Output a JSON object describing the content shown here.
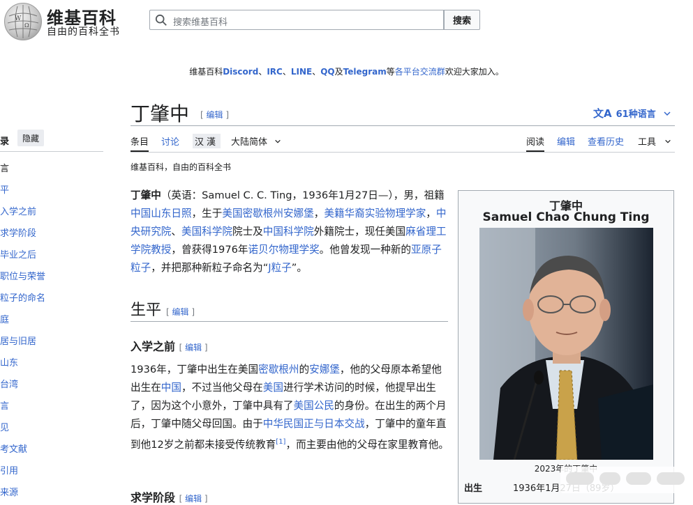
{
  "site": {
    "title": "维基百科",
    "tagline": "自由的百科全书"
  },
  "search": {
    "placeholder": "搜索维基百科",
    "button": "搜索"
  },
  "banner": {
    "prefix": "维基百科",
    "discord": "Discord",
    "sep1": "、",
    "irc": "IRC",
    "sep2": "、",
    "line": "LINE",
    "sep3": "、",
    "qq": "QQ",
    "and": "及",
    "telegram": "Telegram",
    "mid": "等",
    "link": "各平台交流群",
    "suffix": "欢迎大家加入。"
  },
  "toc": {
    "title": "录",
    "hide_button": "隐藏",
    "items": [
      "言",
      "平",
      "入学之前",
      "求学阶段",
      "毕业之后",
      "职位与荣誉",
      "粒子的命名",
      "庭",
      "居与旧居",
      "山东",
      "台湾",
      "言",
      "见",
      "考文献",
      "引用",
      "来源"
    ]
  },
  "page": {
    "title": "丁肇中",
    "edit": "编辑",
    "languages": "61种语言"
  },
  "tabs": {
    "article": "条目",
    "talk": "讨论",
    "variant": "汉漢",
    "variant_menu": "大陆简体",
    "read": "阅读",
    "edit": "编辑",
    "history": "查看历史",
    "tools": "工具"
  },
  "from_line": "维基百科，自由的百科全书",
  "lead": {
    "t1": "丁肇中",
    "t2": "（英语：Samuel C. C. Ting，1936年1月27日—），男，祖籍",
    "l1": "中国山东日照",
    "t3": "，生于",
    "l2": "美国密歇根州安娜堡",
    "t4": "，",
    "l3": "美籍华裔实验物理学家",
    "t5": "，",
    "l4": "中央研究院",
    "t6": "、",
    "l5": "美国科学院",
    "t7": "院士及",
    "l6": "中国科学院",
    "t8": "外籍院士，现任美国",
    "l7": "麻省理工学院教授",
    "t9": "，曾获得1976年",
    "l8": "诺贝尔物理学奖",
    "t10": "。他曾发现一种新的",
    "l9": "亚原子粒子",
    "t11": "，并把那种新粒子命名为“",
    "l10": "J粒子",
    "t12": "”。"
  },
  "section1": {
    "heading": "生平",
    "edit": "编辑"
  },
  "section1_1": {
    "heading": "入学之前",
    "edit": "编辑",
    "t1": "1936年，丁肇中出生在美国",
    "l1": "密歇根州",
    "t2": "的",
    "l2": "安娜堡",
    "t3": "，他的父母原本希望他出生在",
    "l3": "中国",
    "t4": "，不过当他父母在",
    "l4": "美国",
    "t5": "进行学术访问的时候，他提早出生了，因为这个小意外，丁肇中具有了",
    "l5": "美国公民",
    "t6": "的身份。在出生的两个月后，丁肇中随父母回国。由于",
    "l6": "中华民国正与日本交战",
    "t7": "，丁肇中的童年直到他12岁之前都未接受传统教育",
    "ref": "[1]",
    "t8": "，而主要由他的父母在家里教育他。"
  },
  "section1_2": {
    "heading": "求学阶段",
    "edit": "编辑"
  },
  "infobox": {
    "title_zh": "丁肇中",
    "title_en": "Samuel Chao Chung Ting",
    "caption": "2023年的丁肇中",
    "birth_label": "出生",
    "birth_value": "1936年1月27日（89岁）"
  },
  "colors": {
    "link": "#3366cc",
    "text": "#202122",
    "border": "#a2a9b1"
  }
}
